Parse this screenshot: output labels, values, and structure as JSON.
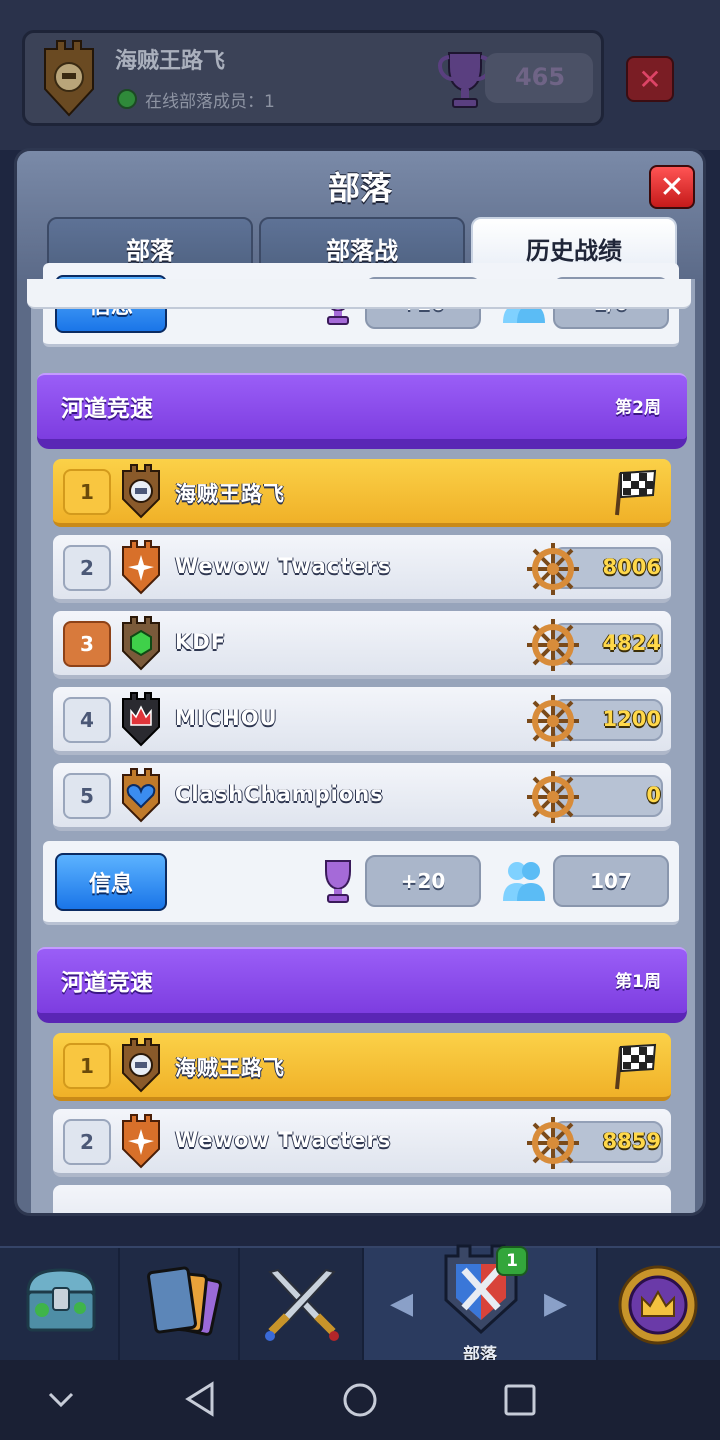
{
  "clan_header": {
    "name": "海贼王路飞",
    "online_label": "在线部落成员：1",
    "trophies": "465"
  },
  "popup": {
    "title": "部落",
    "tabs": [
      {
        "label": "部落",
        "active": false
      },
      {
        "label": "部落战",
        "active": false
      },
      {
        "label": "历史战绩",
        "active": true
      }
    ]
  },
  "info_bar_1": {
    "button": "信息",
    "trophy_change": "+20",
    "members": "1/0"
  },
  "info_bar_2": {
    "button": "信息",
    "trophy_change": "+20",
    "members": "107"
  },
  "races": [
    {
      "title": "河道竞速",
      "week": "第2周",
      "rows": [
        {
          "rank": "1",
          "name": "海贼王路飞",
          "score": null,
          "finished": true
        },
        {
          "rank": "2",
          "name": "Wewow Twacters",
          "score": "8006",
          "finished": false
        },
        {
          "rank": "3",
          "name": "KDF",
          "score": "4824",
          "finished": false
        },
        {
          "rank": "4",
          "name": "MICHOU",
          "score": "1200",
          "finished": false
        },
        {
          "rank": "5",
          "name": "ClashChampions",
          "score": "0",
          "finished": false
        }
      ]
    },
    {
      "title": "河道竞速",
      "week": "第1周",
      "rows": [
        {
          "rank": "1",
          "name": "海贼王路飞",
          "score": null,
          "finished": true
        },
        {
          "rank": "2",
          "name": "Wewow Twacters",
          "score": "8859",
          "finished": false
        }
      ]
    }
  ],
  "bottom_nav": {
    "items": [
      {
        "icon": "treasure-chest-icon"
      },
      {
        "icon": "cards-icon"
      },
      {
        "icon": "crossed-swords-icon"
      },
      {
        "icon": "clan-shield-icon",
        "label": "部落",
        "badge": "1",
        "active": true
      },
      {
        "icon": "tournament-crown-icon"
      }
    ]
  },
  "colors": {
    "accent_purple": "#8a4cf0",
    "gold_row": "#f5be33",
    "info_blue": "#2a86f0",
    "close_red": "#e02a2a"
  }
}
